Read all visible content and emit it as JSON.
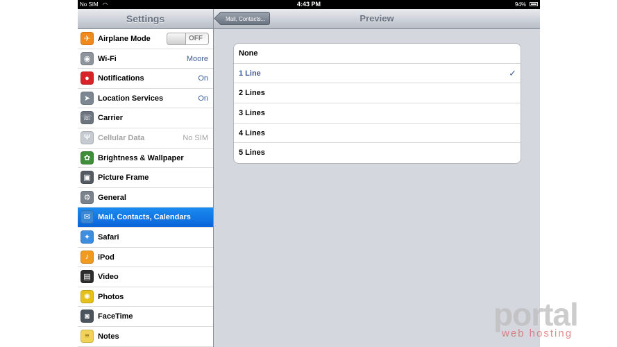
{
  "status_bar": {
    "carrier": "No SIM",
    "time": "4:43 PM",
    "battery": "94%"
  },
  "sidebar": {
    "title": "Settings",
    "items": [
      {
        "label": "Airplane Mode",
        "icon": "airplane-icon",
        "toggle": "OFF"
      },
      {
        "label": "Wi-Fi",
        "icon": "wifi-icon",
        "value": "Moore"
      },
      {
        "label": "Notifications",
        "icon": "notifications-icon",
        "value": "On"
      },
      {
        "label": "Location Services",
        "icon": "location-icon",
        "value": "On"
      },
      {
        "label": "Carrier",
        "icon": "phone-icon"
      },
      {
        "label": "Cellular Data",
        "icon": "antenna-icon",
        "value": "No SIM",
        "disabled": true
      },
      {
        "label": "Brightness & Wallpaper",
        "icon": "flower-icon"
      },
      {
        "label": "Picture Frame",
        "icon": "picture-frame-icon"
      },
      {
        "label": "General",
        "icon": "gear-icon"
      },
      {
        "label": "Mail, Contacts, Calendars",
        "icon": "mail-icon",
        "selected": true
      },
      {
        "label": "Safari",
        "icon": "compass-icon"
      },
      {
        "label": "iPod",
        "icon": "music-note-icon"
      },
      {
        "label": "Video",
        "icon": "clapperboard-icon"
      },
      {
        "label": "Photos",
        "icon": "sunflower-icon"
      },
      {
        "label": "FaceTime",
        "icon": "camera-icon"
      },
      {
        "label": "Notes",
        "icon": "notepad-icon"
      }
    ]
  },
  "detail": {
    "back_label": "Mail, Contacts...",
    "title": "Preview",
    "options": [
      {
        "label": "None"
      },
      {
        "label": "1 Line",
        "checked": true
      },
      {
        "label": "2 Lines"
      },
      {
        "label": "3 Lines"
      },
      {
        "label": "4 Lines"
      },
      {
        "label": "5 Lines"
      }
    ],
    "check_glyph": "✓"
  },
  "watermark": {
    "main": "portal",
    "sub": "web hosting"
  },
  "colors": {
    "accent": "#3d5c97",
    "selection": "#1178e6",
    "status_bar": "#000000"
  }
}
